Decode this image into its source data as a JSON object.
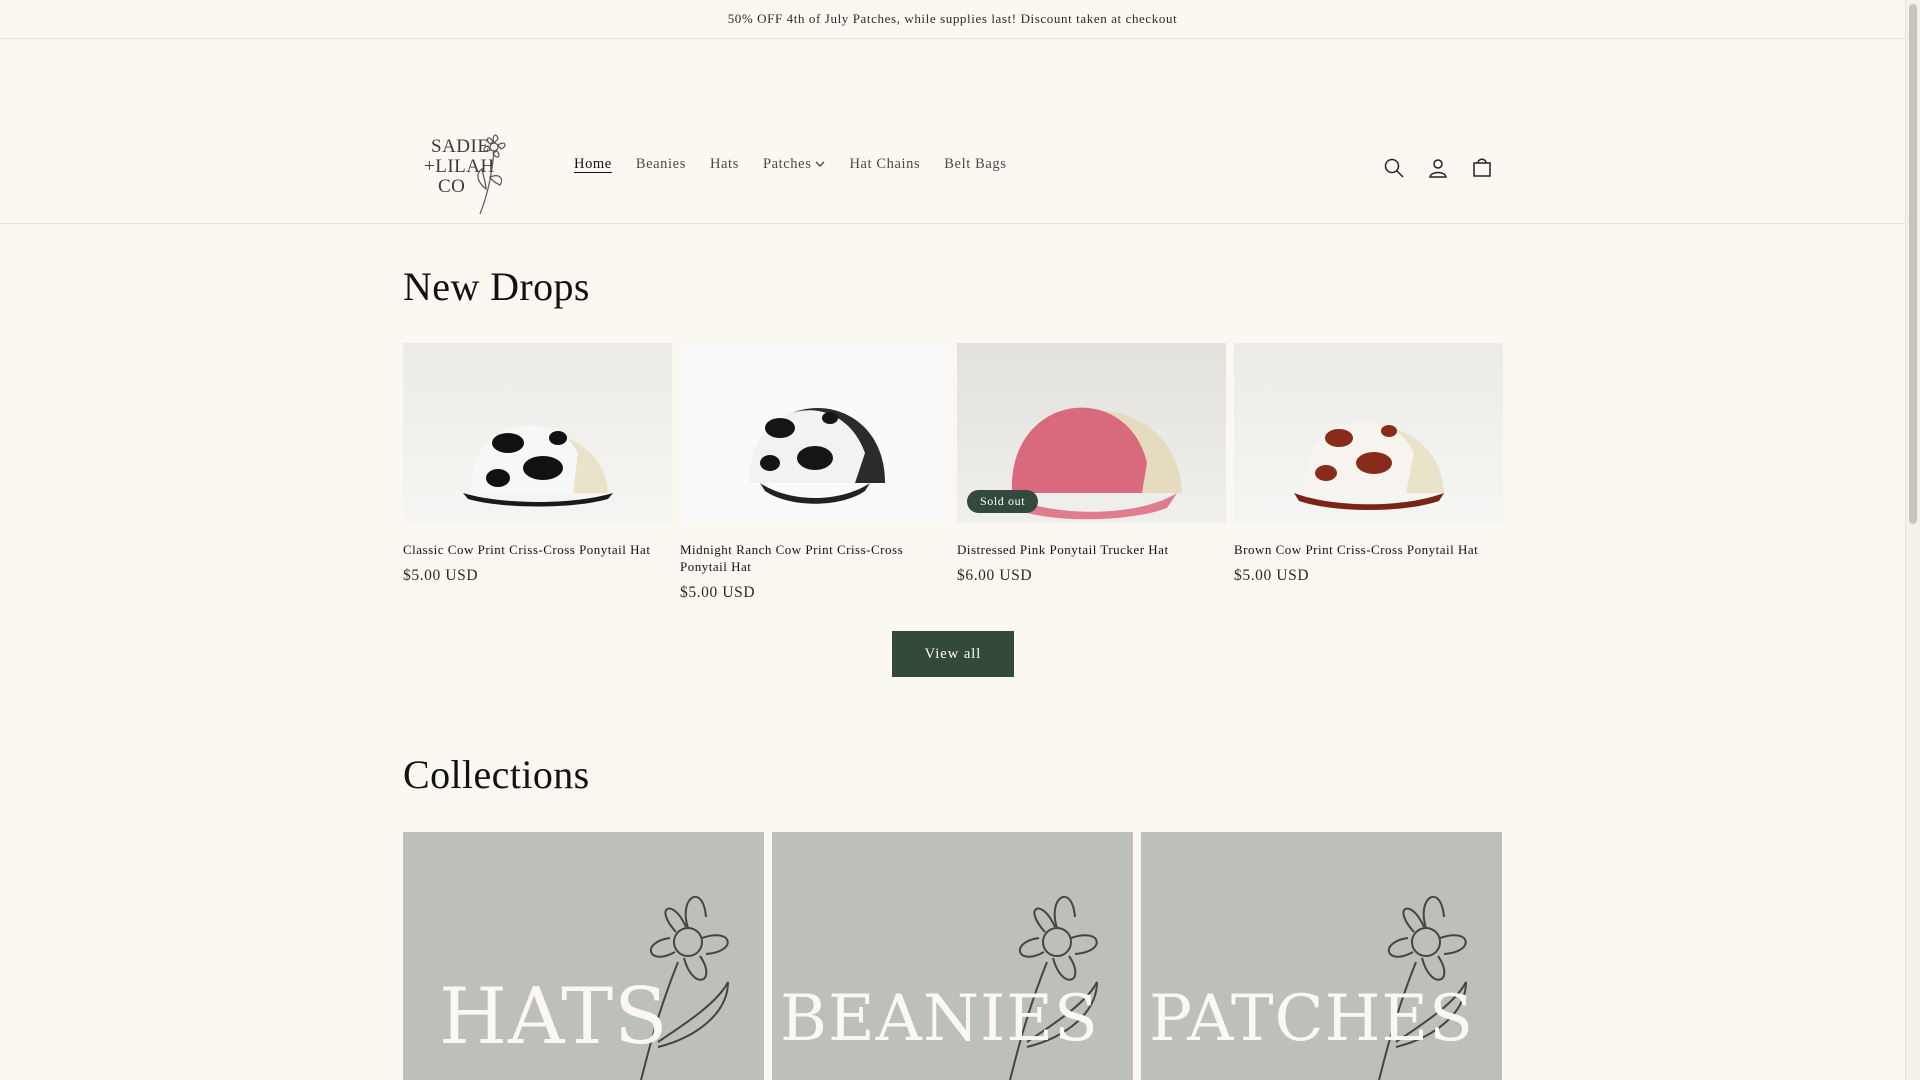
{
  "announcement": "50% OFF 4th of July Patches, while supplies last! Discount taken at checkout",
  "logo": {
    "lines": [
      "SADIE",
      "+LILAH",
      "CO"
    ]
  },
  "nav": [
    {
      "label": "Home",
      "active": true
    },
    {
      "label": "Beanies"
    },
    {
      "label": "Hats"
    },
    {
      "label": "Patches",
      "has_dropdown": true
    },
    {
      "label": "Hat Chains"
    },
    {
      "label": "Belt Bags"
    }
  ],
  "header_icons": [
    "search-icon",
    "account-icon",
    "cart-icon"
  ],
  "new_drops": {
    "title": "New Drops",
    "products": [
      {
        "name": "Classic Cow Print Criss-Cross Ponytail Hat",
        "price": "$5.00 USD"
      },
      {
        "name": "Midnight Ranch Cow Print Criss-Cross Ponytail Hat",
        "price": "$5.00 USD"
      },
      {
        "name": "Distressed Pink Ponytail Trucker Hat",
        "price": "$6.00 USD",
        "badge": "Sold out"
      },
      {
        "name": "Brown Cow Print Criss-Cross Ponytail Hat",
        "price": "$5.00 USD"
      }
    ],
    "view_all": "View all"
  },
  "collections": {
    "title": "Collections",
    "items": [
      {
        "label": "HATS"
      },
      {
        "label": "BEANIES"
      },
      {
        "label": "PATCHES"
      }
    ]
  },
  "colors": {
    "background": "#fbf8f1",
    "accent": "#334a3b",
    "collection_bg": "#bcc0b8"
  }
}
